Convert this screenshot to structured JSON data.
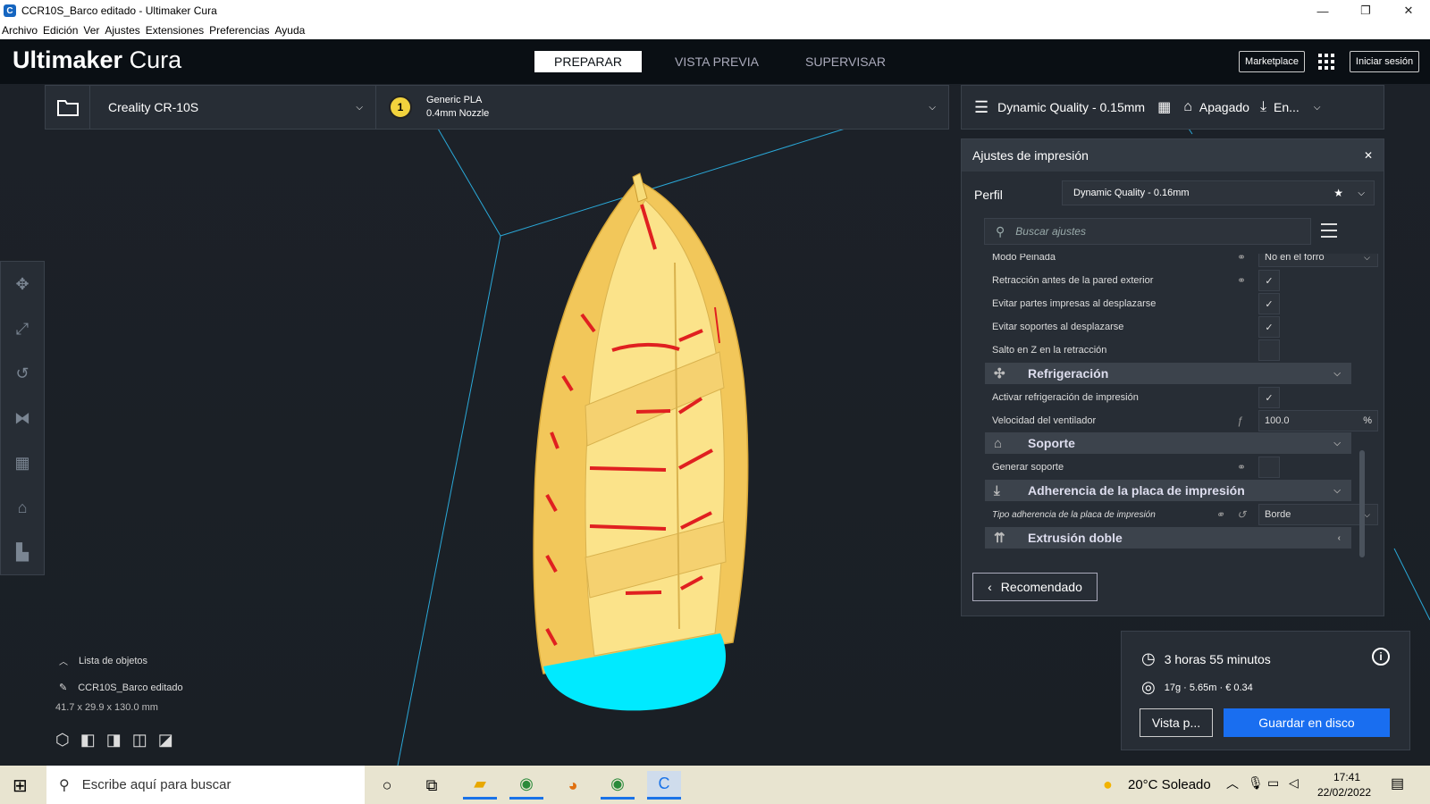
{
  "window": {
    "title": "CCR10S_Barco editado - Ultimaker Cura",
    "app_letter": "C"
  },
  "menu": [
    "Archivo",
    "Edición",
    "Ver",
    "Ajustes",
    "Extensiones",
    "Preferencias",
    "Ayuda"
  ],
  "header": {
    "logo_bold": "Ultimaker",
    "logo_light": " Cura",
    "tabs": [
      "PREPARAR",
      "VISTA PREVIA",
      "SUPERVISAR"
    ],
    "marketplace": "Marketplace",
    "signin": "Iniciar sesión"
  },
  "printer": {
    "name": "Creality CR-10S",
    "extruder_num": "1",
    "material": "Generic PLA",
    "nozzle": "0.4mm Nozzle"
  },
  "print_bar": {
    "profile": "Dynamic Quality - 0.15mm",
    "support": "Apagado",
    "adhesion": "En..."
  },
  "settings_panel": {
    "title": "Ajustes de impresión",
    "profile_label": "Perfil",
    "profile_value": "Dynamic Quality - 0.16mm",
    "search_placeholder": "Buscar ajustes",
    "rows": {
      "combing": {
        "label": "Modo Peinada",
        "value": "No en el forro"
      },
      "retract_outer": "Retracción antes de la pared exterior",
      "avoid_printed": "Evitar partes impresas al desplazarse",
      "avoid_supports": "Evitar soportes al desplazarse",
      "z_hop": "Salto en Z en la retracción",
      "enable_cooling": "Activar refrigeración de impresión",
      "fan_speed": {
        "label": "Velocidad del ventilador",
        "value": "100.0",
        "unit": "%"
      },
      "gen_support": "Generar soporte",
      "adhesion_type": {
        "label": "Tipo adherencia de la placa de impresión",
        "value": "Borde"
      }
    },
    "categories": {
      "cooling": "Refrigeración",
      "support": "Soporte",
      "adhesion": "Adherencia de la placa de impresión",
      "dual": "Extrusión doble"
    },
    "recommended": "Recomendado"
  },
  "action_panel": {
    "time": "3 horas 55 minutos",
    "material": "17g · 5.65m · € 0.34",
    "preview": "Vista p...",
    "save": "Guardar en disco"
  },
  "object_list": {
    "toggle": "Lista de objetos",
    "name": "CCR10S_Barco editado",
    "dims": "41.7 x 29.9 x 130.0 mm"
  },
  "taskbar": {
    "search": "Escribe aquí para buscar",
    "weather": "20°C  Soleado",
    "time": "17:41",
    "date": "22/02/2022"
  },
  "colors": {
    "accent": "#196ef0",
    "model": "#f7d368",
    "overhang": "#e02020",
    "brim": "#00eaff"
  }
}
